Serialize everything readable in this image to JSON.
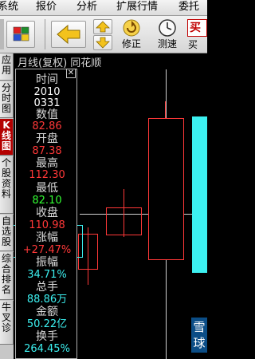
{
  "menu": {
    "items": [
      "系统",
      "报价",
      "分析",
      "扩展行情",
      "委托"
    ]
  },
  "toolbar": {
    "revise_label": "修正",
    "speed_test_label": "测速",
    "buy_label": "买",
    "sell_label": "买"
  },
  "left_tabs": [
    {
      "label": "应\n用",
      "active": false
    },
    {
      "label": "分\n时\n图",
      "active": false
    },
    {
      "label": "K\n线\n图",
      "active": true
    },
    {
      "label": "个\n股\n资\n料",
      "active": false
    },
    {
      "label": "自\n选\n股",
      "active": false
    },
    {
      "label": "综\n合\n排\n名",
      "active": false
    },
    {
      "label": "牛\n叉\n诊",
      "active": false
    }
  ],
  "chart": {
    "title": "月线(复权)  同花顺"
  },
  "info": {
    "time_label": "时间",
    "year": "2010",
    "date": "0331",
    "value_label": "数值",
    "value": "82.86",
    "open_label": "开盘",
    "open": "87.38",
    "high_label": "最高",
    "high": "112.30",
    "low_label": "最低",
    "low": "82.10",
    "close_label": "收盘",
    "close": "110.98",
    "change_label": "涨幅",
    "change": "+27.47%",
    "amplitude_label": "振幅",
    "amplitude": "34.71%",
    "volume_label": "总手",
    "volume": "88.86万",
    "amount_label": "金额",
    "amount": "50.22亿",
    "turnover_label": "换手",
    "turnover": "264.45%"
  },
  "logo": {
    "text": "雪\n球"
  },
  "colors": {
    "rise": "#ff3838",
    "fall": "#33ff33",
    "highlight": "#3cf0f0",
    "crosshair": "#ffffff"
  },
  "icons": [
    "color-grid-icon",
    "back-arrow-icon",
    "up-arrow-icon",
    "down-arrow-icon",
    "refresh-icon",
    "clock-icon"
  ]
}
